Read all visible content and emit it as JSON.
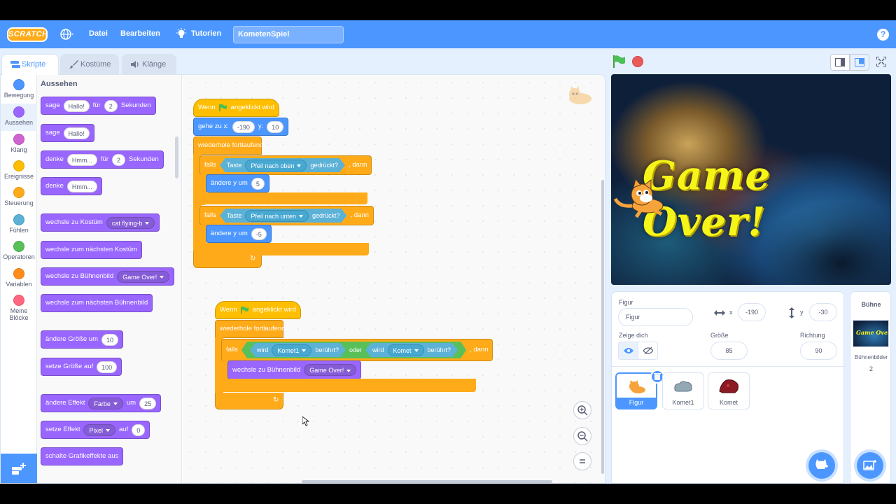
{
  "menu": {
    "logo": "SCRATCH",
    "file": "Datei",
    "edit": "Bearbeiten",
    "tutorials": "Tutorien",
    "project_title": "KometenSpiel",
    "help": "?"
  },
  "tabs": [
    {
      "label": "Skripte",
      "icon": "code-icon"
    },
    {
      "label": "Kostüme",
      "icon": "brush-icon"
    },
    {
      "label": "Klänge",
      "icon": "speaker-icon"
    }
  ],
  "categories": [
    {
      "label": "Bewegung",
      "color": "#4c97ff"
    },
    {
      "label": "Aussehen",
      "color": "#9966ff"
    },
    {
      "label": "Klang",
      "color": "#cf63cf"
    },
    {
      "label": "Ereignisse",
      "color": "#ffbf00"
    },
    {
      "label": "Steuerung",
      "color": "#ffab19"
    },
    {
      "label": "Fühlen",
      "color": "#5cb1d6"
    },
    {
      "label": "Operatoren",
      "color": "#59c059"
    },
    {
      "label": "Variablen",
      "color": "#ff8c1a"
    },
    {
      "label": "Meine Blöcke",
      "color": "#ff6680"
    }
  ],
  "palette": {
    "title": "Aussehen",
    "say_for": {
      "word": "sage",
      "msg": "Hallo!",
      "for": "für",
      "secs": "2",
      "unit": "Sekunden"
    },
    "say": {
      "word": "sage",
      "msg": "Hallo!"
    },
    "think_for": {
      "word": "denke",
      "msg": "Hmm...",
      "for": "für",
      "secs": "2",
      "unit": "Sekunden"
    },
    "think": {
      "word": "denke",
      "msg": "Hmm..."
    },
    "switch_costume": {
      "text": "wechsle zu Kostüm",
      "value": "cat flying-b"
    },
    "next_costume": "wechsle zum nächsten Kostüm",
    "switch_backdrop": {
      "text": "wechsle zu Bühnenbild",
      "value": "Game Over!"
    },
    "next_backdrop": "wechsle zum nächsten Bühnenbild",
    "change_size": {
      "text": "ändere Größe um",
      "value": "10"
    },
    "set_size": {
      "text": "setze Größe auf",
      "value": "100"
    },
    "change_effect": {
      "text": "ändere Effekt",
      "effect": "Farbe",
      "by": "um",
      "value": "25"
    },
    "set_effect": {
      "text": "setze Effekt",
      "effect": "Pixel",
      "to": "auf",
      "value": "0"
    },
    "clear_effects": "schalte Grafikeffekte aus"
  },
  "script1": {
    "hat": {
      "when": "Wenn",
      "clicked": "angeklickt wird"
    },
    "goto": {
      "text": "gehe zu x:",
      "x": "-190",
      "ylabel": "y:",
      "y": "10"
    },
    "forever": "wiederhole fortlaufend",
    "if1": {
      "if": "falls",
      "key": "Taste",
      "keyval": "Pfeil nach oben",
      "pressed": "gedrückt?",
      "then": ", dann"
    },
    "change1": {
      "text": "ändere y um",
      "value": "5"
    },
    "if2": {
      "if": "falls",
      "key": "Taste",
      "keyval": "Pfeil nach unten",
      "pressed": "gedrückt?",
      "then": ", dann"
    },
    "change2": {
      "text": "ändere y um",
      "value": "-5"
    }
  },
  "script2": {
    "hat": {
      "when": "Wenn",
      "clicked": "angeklickt wird"
    },
    "forever": "wiederhole fortlaufend",
    "if": "falls",
    "cond1": {
      "will": "wird",
      "sprite": "Komet1",
      "touched": "berührt?"
    },
    "or": "oder",
    "cond2": {
      "will": "wird",
      "sprite": "Komet",
      "touched": "berührt?"
    },
    "then": ", dann",
    "switch": {
      "text": "wechsle zu Bühnenbild",
      "value": "Game Over!"
    }
  },
  "stage": {
    "text": "Game Over!"
  },
  "sprite_info": {
    "sprite_label": "Figur",
    "sprite_name": "Figur",
    "x_label": "x",
    "x": "-190",
    "y_label": "y",
    "y": "-30",
    "show_label": "Zeige dich",
    "size_label": "Größe",
    "size": "85",
    "direction_label": "Richtung",
    "direction": "90"
  },
  "sprites": [
    {
      "name": "Figur",
      "selected": true
    },
    {
      "name": "Komet1",
      "selected": false
    },
    {
      "name": "Komet",
      "selected": false
    }
  ],
  "stage_pane": {
    "title": "Bühne",
    "thumb_text": "Game Over!",
    "backdrops_label": "Bühnenbilder",
    "backdrops_count": "2"
  },
  "colors": {
    "menubar": "#4c97ff",
    "looks": "#9966ff",
    "events": "#ffbf00",
    "control": "#ffab19",
    "sensing": "#5cb1d6",
    "operators": "#59c059"
  }
}
